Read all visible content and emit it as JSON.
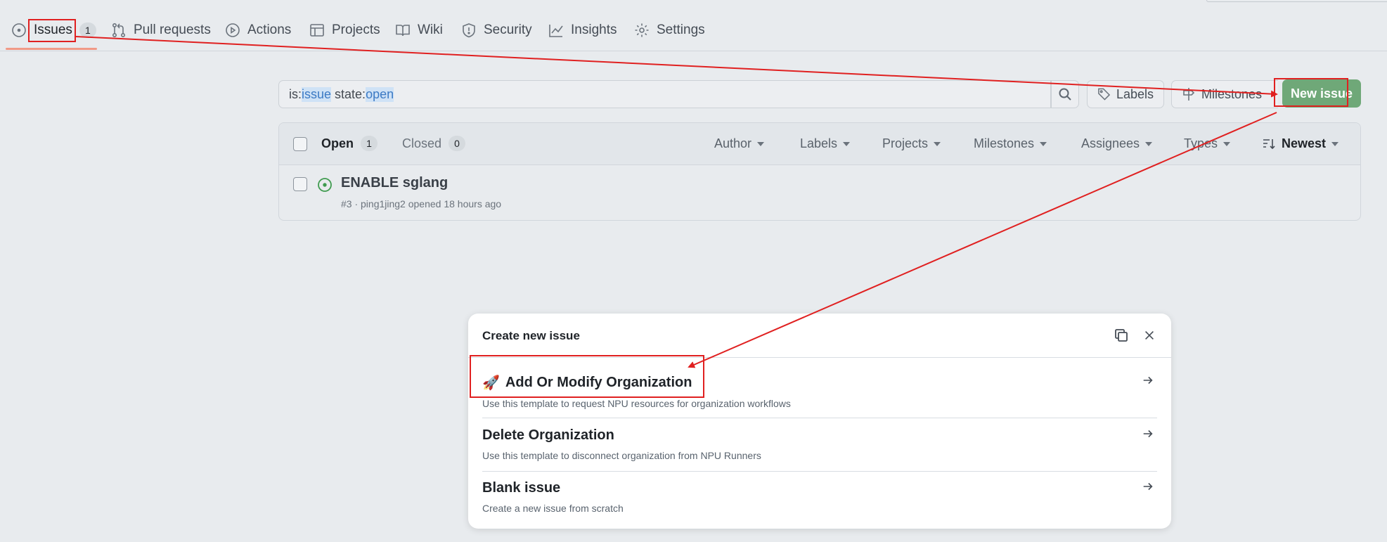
{
  "nav": {
    "issues": "Issues",
    "issues_count": "1",
    "pull_requests": "Pull requests",
    "actions": "Actions",
    "projects": "Projects",
    "wiki": "Wiki",
    "security": "Security",
    "insights": "Insights",
    "settings": "Settings"
  },
  "search": {
    "prefix1": "is:",
    "token1": "issue",
    "prefix2": " state:",
    "token2": "open"
  },
  "toolbar": {
    "labels": "Labels",
    "milestones": "Milestones",
    "new_issue": "New issue"
  },
  "list": {
    "open_label": "Open",
    "open_count": "1",
    "closed_label": "Closed",
    "closed_count": "0",
    "filters": {
      "author": "Author",
      "labels": "Labels",
      "projects": "Projects",
      "milestones": "Milestones",
      "assignees": "Assignees",
      "types": "Types",
      "sort": "Newest"
    },
    "issues": [
      {
        "title": "ENABLE sglang",
        "meta": "#3 · ping1jing2 opened 18 hours ago"
      }
    ]
  },
  "dialog": {
    "title": "Create new issue",
    "templates": [
      {
        "name": "Add Or Modify Organization",
        "desc": "Use this template to request NPU resources for organization workflows",
        "emoji": "🚀"
      },
      {
        "name": "Delete Organization",
        "desc": "Use this template to disconnect organization from NPU Runners"
      },
      {
        "name": "Blank issue",
        "desc": "Create a new issue from scratch"
      }
    ]
  },
  "colors": {
    "annotation": "#e02020",
    "new_issue_bg": "#6fa878",
    "open_icon": "#3f9b4f"
  }
}
